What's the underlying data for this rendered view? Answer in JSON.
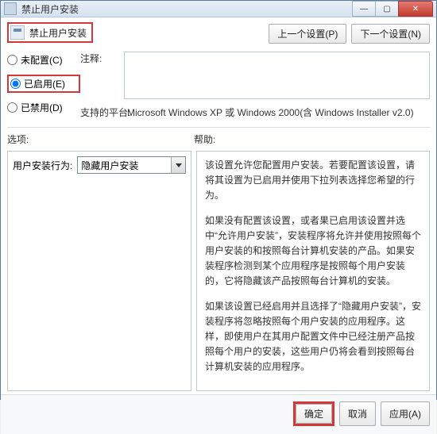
{
  "window": {
    "title": "禁止用户安装"
  },
  "header": {
    "policy_title": "禁止用户安装",
    "prev_setting": "上一个设置(P)",
    "next_setting": "下一个设置(N)"
  },
  "radios": {
    "not_configured": "未配置(C)",
    "enabled": "已启用(E)",
    "disabled": "已禁用(D)",
    "selected": "enabled"
  },
  "labels": {
    "comment": "注释:",
    "platform": "支持的平台:",
    "options": "选项:",
    "help": "帮助:",
    "behavior": "用户安装行为:"
  },
  "platform_text": "Microsoft Windows XP 或 Windows 2000(含 Windows Installer v2.0)",
  "combo": {
    "selected": "隐藏用户安装"
  },
  "help_paragraphs": [
    "该设置允许您配置用户安装。若要配置该设置，请将其设置为已启用并使用下拉列表选择您希望的行为。",
    "如果没有配置该设置，或者果已启用该设置并选中“允许用户安装”，安装程序将允许并使用按照每个用户安装的和按照每台计算机安装的产品。如果安装程序检测到某个应用程序是按照每个用户安装的，它将隐藏该产品按照每台计算机的安装。",
    "如果该设置已经启用并且选择了“隐藏用户安装”，安装程序将忽略按照每个用户安装的应用程序。这样，即使用户在其用户配置文件中已经注册产品按照每个用户的安装，这些用户仍将会看到按照每台计算机安装的应用程序。"
  ],
  "footer": {
    "ok": "确定",
    "cancel": "取消",
    "apply": "应用(A)"
  }
}
